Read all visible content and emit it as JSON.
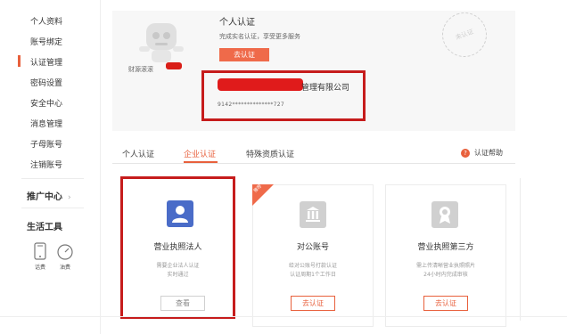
{
  "sidebar": {
    "items": [
      {
        "label": "个人资料"
      },
      {
        "label": "账号绑定"
      },
      {
        "label": "认证管理"
      },
      {
        "label": "密码设置"
      },
      {
        "label": "安全中心"
      },
      {
        "label": "消息管理"
      },
      {
        "label": "子母账号"
      },
      {
        "label": "注销账号"
      }
    ],
    "promo_label": "推广中心",
    "promo_chevron": "›",
    "tools_title": "生活工具",
    "tools": [
      {
        "label": "话费",
        "icon": "phone-icon"
      },
      {
        "label": "油费",
        "icon": "gauge-icon"
      }
    ]
  },
  "profile": {
    "username": "财源滚滚",
    "title": "个人认证",
    "description": "完成实名认证，享受更多服务",
    "button": "去认证",
    "stamp_text": "未认证",
    "company_suffix": "管理有限公司",
    "license_no": "9142**************727"
  },
  "tabs": [
    {
      "label": "个人认证",
      "active": false
    },
    {
      "label": "企业认证",
      "active": true
    },
    {
      "label": "特殊资质认证",
      "active": false
    }
  ],
  "help_label": "认证帮助",
  "cards": [
    {
      "title": "营业执照法人",
      "desc1": "需要企业法人认证",
      "desc2": "实时通过",
      "button": "查看",
      "icon": "person-icon"
    },
    {
      "title": "对公账号",
      "desc1": "给对公账号打款认证",
      "desc2": "认证周期1个工作日",
      "button": "去认证",
      "icon": "bank-icon"
    },
    {
      "title": "营业执照第三方",
      "desc1": "需上传清晰营业执照照片",
      "desc2": "24小时内完成审核",
      "button": "去认证",
      "icon": "badge-icon"
    }
  ],
  "ribbon_text": "推荐",
  "colors": {
    "accent": "#e8603c",
    "highlight_box": "#c61c1c"
  }
}
